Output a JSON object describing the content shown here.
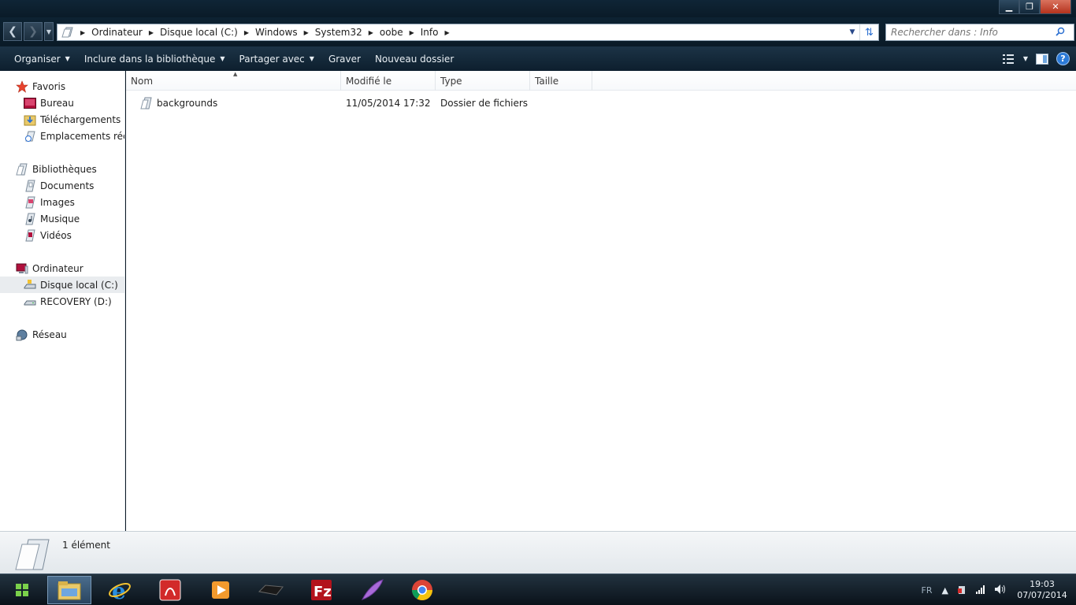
{
  "window": {
    "minimize_glyph": "▁",
    "maximize_glyph": "❐",
    "close_glyph": "✕"
  },
  "address": {
    "breadcrumbs": [
      "Ordinateur",
      "Disque local (C:)",
      "Windows",
      "System32",
      "oobe",
      "Info"
    ]
  },
  "search": {
    "placeholder": "Rechercher dans : Info"
  },
  "toolbar": {
    "organize": "Organiser",
    "include_library": "Inclure dans la bibliothèque",
    "share_with": "Partager avec",
    "burn": "Graver",
    "new_folder": "Nouveau dossier"
  },
  "nav": {
    "favorites": {
      "label": "Favoris",
      "items": [
        "Bureau",
        "Téléchargements",
        "Emplacements récents"
      ]
    },
    "libraries": {
      "label": "Bibliothèques",
      "items": [
        "Documents",
        "Images",
        "Musique",
        "Vidéos"
      ]
    },
    "computer": {
      "label": "Ordinateur",
      "items": [
        "Disque local (C:)",
        "RECOVERY (D:)"
      ],
      "selected": "Disque local (C:)"
    },
    "network": {
      "label": "Réseau"
    }
  },
  "columns": [
    "Nom",
    "Modifié le",
    "Type",
    "Taille"
  ],
  "files": [
    {
      "name": "backgrounds",
      "modified": "11/05/2014 17:32",
      "type": "Dossier de fichiers",
      "size": ""
    }
  ],
  "details": {
    "count": "1 élément"
  },
  "taskbar": {
    "apps": [
      "file-explorer",
      "internet-explorer",
      "acrobat-reader",
      "media-player",
      "console",
      "filezilla",
      "feather-app",
      "chrome"
    ],
    "language": "FR",
    "time": "19:03",
    "date": "07/07/2014"
  },
  "colors": {
    "chrome_dark": "#0d1a26",
    "toolbar": "#1c3346",
    "accent_blue": "#2c7bd8",
    "selection": "#e9ecef"
  }
}
